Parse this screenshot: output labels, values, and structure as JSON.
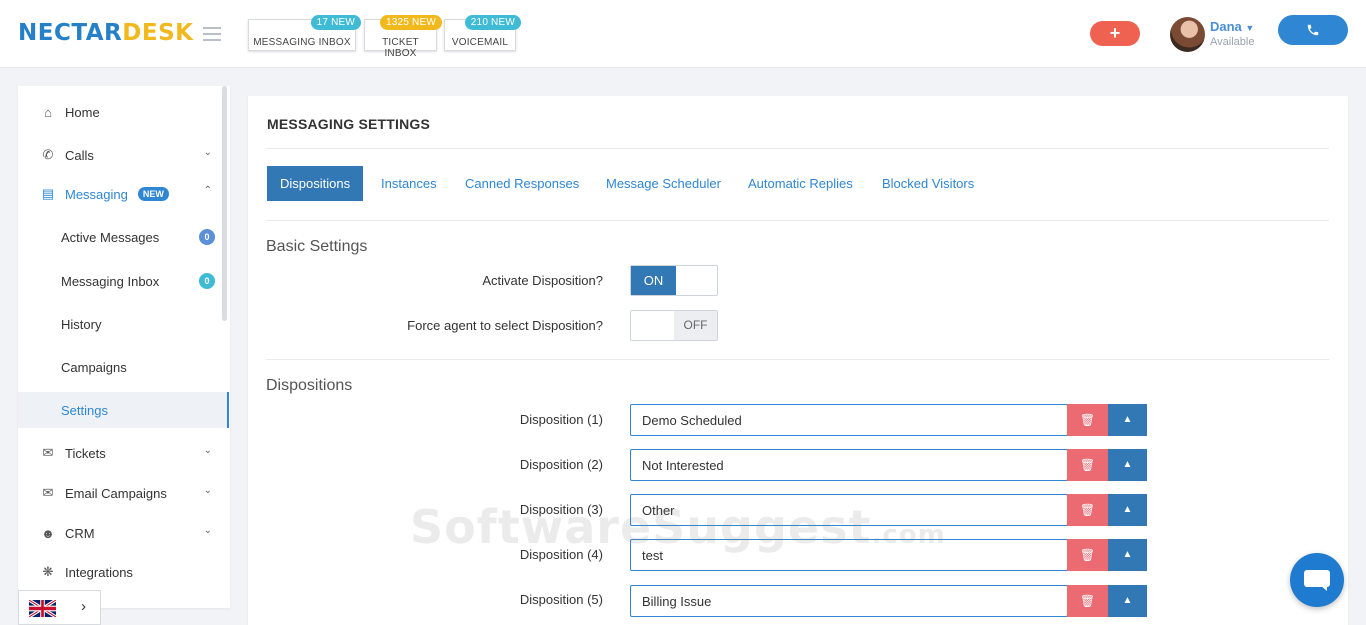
{
  "header": {
    "logo_part1": "NECTAR",
    "logo_part2": "DESK",
    "inbox_buttons": [
      {
        "label": "MESSAGING INBOX",
        "badge": "17 NEW",
        "badge_color": "#3fbbd6"
      },
      {
        "label": "TICKET INBOX",
        "badge": "1325 NEW",
        "badge_color": "#f2b91e"
      },
      {
        "label": "VOICEMAIL",
        "badge": "210 NEW",
        "badge_color": "#3fbbd6"
      }
    ],
    "add_label": "+",
    "user": {
      "name": "Dana",
      "status": "Available"
    }
  },
  "sidebar": {
    "items": [
      {
        "label": "Home",
        "icon": "home-icon"
      },
      {
        "label": "Calls",
        "icon": "phone-icon"
      },
      {
        "label": "Messaging",
        "icon": "chat-icon",
        "tag": "NEW"
      },
      {
        "label": "Tickets",
        "icon": "envelope-icon"
      },
      {
        "label": "Email Campaigns",
        "icon": "envelope-icon"
      },
      {
        "label": "CRM",
        "icon": "user-icon"
      },
      {
        "label": "Integrations",
        "icon": "plug-icon"
      }
    ],
    "messaging_sub": [
      {
        "label": "Active Messages",
        "count": "0",
        "count_color": "#5b8fd6"
      },
      {
        "label": "Messaging Inbox",
        "count": "0",
        "count_color": "#3fbbd6"
      },
      {
        "label": "History"
      },
      {
        "label": "Campaigns"
      },
      {
        "label": "Settings"
      }
    ],
    "active_color": "#2f86d2"
  },
  "main": {
    "title": "MESSAGING SETTINGS",
    "tabs": [
      "Dispositions",
      "Instances",
      "Canned Responses",
      "Message Scheduler",
      "Automatic Replies",
      "Blocked Visitors"
    ],
    "active_tab": "Dispositions",
    "basic_settings": {
      "heading": "Basic Settings",
      "activate_label": "Activate Disposition?",
      "activate_value": "ON",
      "force_label": "Force agent to select Disposition?",
      "force_value": "OFF"
    },
    "dispositions": {
      "heading": "Dispositions",
      "rows": [
        {
          "label": "Disposition (1)",
          "value": "Demo Scheduled"
        },
        {
          "label": "Disposition (2)",
          "value": "Not Interested"
        },
        {
          "label": "Disposition (3)",
          "value": "Other"
        },
        {
          "label": "Disposition (4)",
          "value": "test"
        },
        {
          "label": "Disposition (5)",
          "value": "Billing Issue"
        }
      ]
    }
  },
  "watermark": {
    "main": "SoftwareSuggest",
    "suffix": ".com"
  },
  "colors": {
    "primary": "#3278b5",
    "delete": "#ec6b72",
    "accent_blue": "#2f86d2",
    "add_button": "#ef6251"
  }
}
